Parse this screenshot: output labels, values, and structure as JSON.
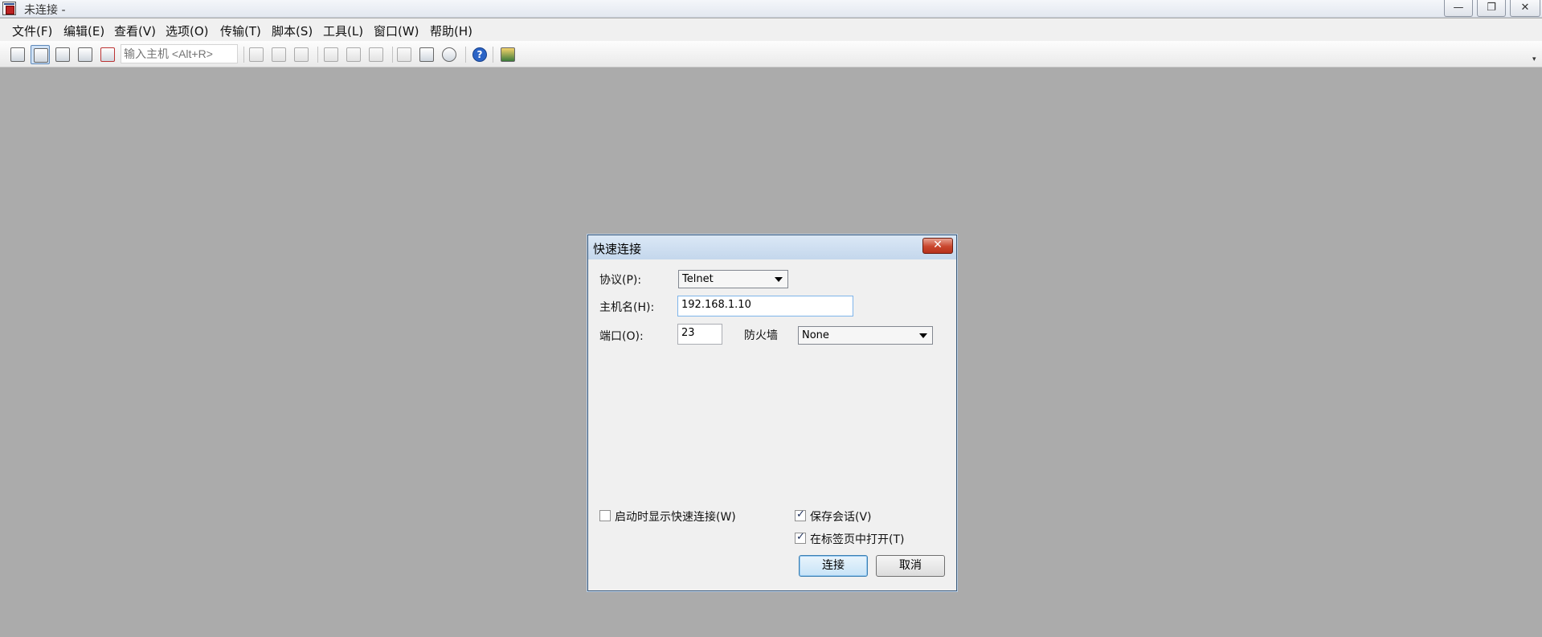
{
  "window": {
    "title": "未连接 -",
    "min_label": "—",
    "max_label": "❐",
    "close_label": "✕"
  },
  "menu": {
    "file": "文件(F)",
    "edit": "编辑(E)",
    "view": "查看(V)",
    "options": "选项(O)",
    "transfer": "传输(T)",
    "script": "脚本(S)",
    "tools": "工具(L)",
    "window": "窗口(W)",
    "help": "帮助(H)"
  },
  "toolbar": {
    "host_placeholder": "输入主机 <Alt+R>",
    "help_glyph": "?",
    "overflow": "▾"
  },
  "dialog": {
    "title": "快速连接",
    "close_label": "✕",
    "protocol_label": "协议(P):",
    "protocol_value": "Telnet",
    "hostname_label": "主机名(H):",
    "hostname_value": "192.168.1.10",
    "port_label": "端口(O):",
    "port_value": "23",
    "firewall_label": "防火墙",
    "firewall_value": "None",
    "show_on_startup_label": "启动时显示快速连接(W)",
    "show_on_startup_checked": false,
    "save_session_label": "保存会话(V)",
    "save_session_checked": true,
    "open_in_tab_label": "在标签页中打开(T)",
    "open_in_tab_checked": true,
    "connect_label": "连接",
    "cancel_label": "取消"
  }
}
